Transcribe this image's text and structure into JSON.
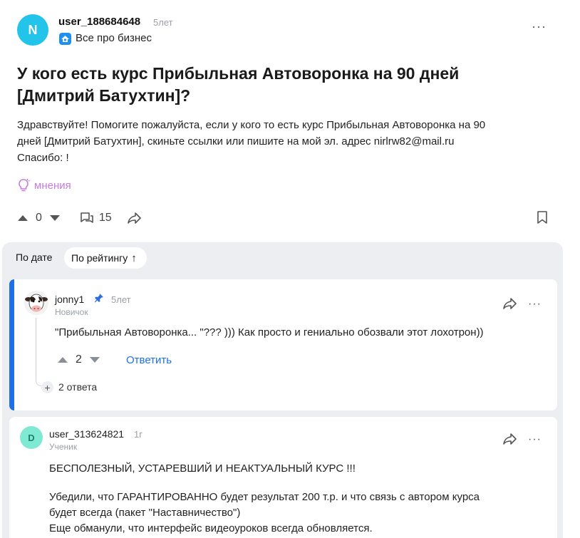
{
  "question": {
    "avatar_letter": "N",
    "author": "user_188684648",
    "age": "5лет",
    "category": "Все про бизнес",
    "title_line1": "У кого есть курс Прибыльная Автоворонка на 90 дней",
    "title_line2": "[Дмитрий Батухтин]?",
    "body_lines": [
      "Здравствуйте! Помогите пожалуйста, если у кого то есть курс Прибыльная Автоворонка на 90",
      "дней [Дмитрий Батухтин], скиньте ссылки или пишите на мой эл. адрес nirlrw82@mail.ru",
      "Спасибо: !"
    ],
    "opinions_label": "мнения",
    "votes": "0",
    "comments_count": "15",
    "more": "···"
  },
  "sort": {
    "by_date": "По дате",
    "by_rating": "По рейтингу",
    "rating_arrow": "↑"
  },
  "answers": [
    {
      "author": "jonny1",
      "age": "5лет",
      "rank": "Новичок",
      "text": "\"Прибыльная Автоворонка... \"??? ))) Как просто и гениально обозвали этот лохотрон))",
      "votes": "2",
      "reply_label": "Ответить",
      "replies_label": "2 ответа",
      "more": "···"
    },
    {
      "avatar_letter": "D",
      "author": "user_313624821",
      "age": "1г",
      "rank": "Ученик",
      "lines": [
        "БЕСПОЛЕЗНЫЙ, УСТАРЕВШИЙ И НЕАКТУАЛЬНЫЙ  КУРС !!!",
        "Убедили, что ГАРАНТИРОВАННО будет результат 200 т.р. и что связь с автором курса",
        "будет всегда (пакет \"Наставничество\")",
        "Еще обманули, что интерфейс видеоуроков всегда обновляется."
      ],
      "more": "···"
    }
  ],
  "colors": {
    "accent": "#1e6fe8",
    "avatar_n": "#23c4ea",
    "avatar_d": "#7fe9d3",
    "opinions": "#c77be0",
    "answers_bg": "#eceef1"
  }
}
